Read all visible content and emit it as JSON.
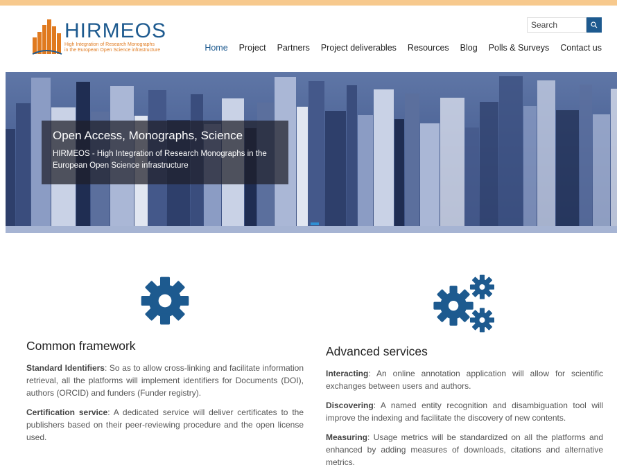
{
  "brand": {
    "name": "HIRMEOS",
    "tagline_line1": "High Integration of Research Monographs",
    "tagline_line2": "in the European Open Science infrastructure"
  },
  "search": {
    "placeholder": "Search",
    "icon": "search-icon"
  },
  "nav": {
    "items": [
      {
        "label": "Home"
      },
      {
        "label": "Project"
      },
      {
        "label": "Partners"
      },
      {
        "label": "Project deliverables"
      },
      {
        "label": "Resources"
      },
      {
        "label": "Blog"
      },
      {
        "label": "Polls & Surveys"
      },
      {
        "label": "Contact us"
      }
    ]
  },
  "hero": {
    "title": "Open Access, Monographs, Science",
    "subtitle": "HIRMEOS - High Integration of Research Monographs in the European Open Science infrastructure"
  },
  "features": {
    "left": {
      "icon": "gear-icon",
      "title": "Common framework",
      "items": [
        {
          "label": "Standard Identifiers",
          "text": ": So as to allow cross-linking and facilitate information retrieval, all the platforms will implement identifiers for Documents (DOI), authors (ORCID) and funders (Funder registry)."
        },
        {
          "label": "Certification service",
          "text": ": A dedicated service will deliver certificates to the publishers based on their peer-reviewing procedure and the open license used."
        }
      ]
    },
    "right": {
      "icon": "gears-icon",
      "title": "Advanced services",
      "items": [
        {
          "label": "Interacting",
          "text": ": An online annotation application will allow for scientific exchanges between users and authors."
        },
        {
          "label": "Discovering",
          "text": ": A named entity recognition and disambiguation tool will improve the indexing and facilitate the discovery of new contents."
        },
        {
          "label": "Measuring",
          "text": ": Usage metrics will be standardized on all the platforms and enhanced by adding measures of downloads, citations and alternative metrics."
        }
      ]
    }
  },
  "colors": {
    "accent": "#1d5a8f",
    "top_bar": "#f7c98d",
    "logo_orange": "#e07a1f"
  }
}
